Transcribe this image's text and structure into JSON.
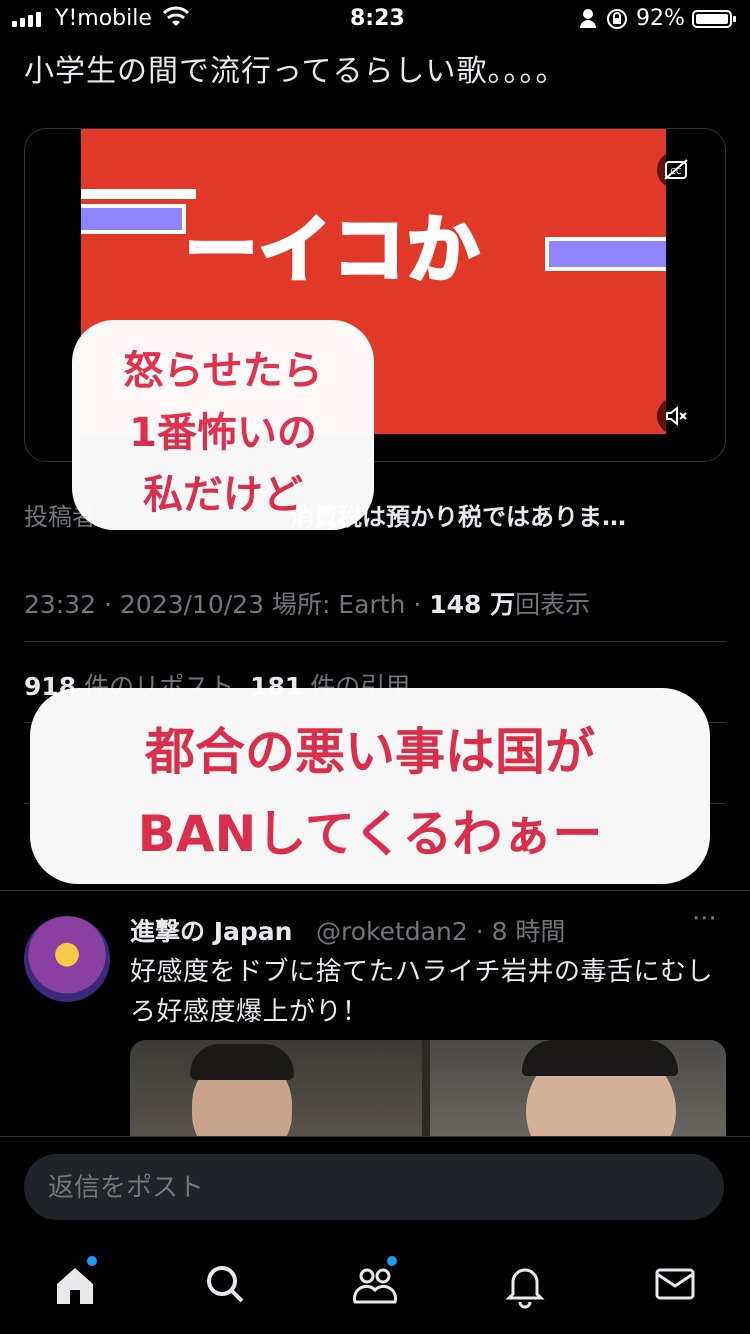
{
  "status_bar": {
    "carrier": "Y!mobile",
    "time": "8:23",
    "battery": "92%"
  },
  "tweet": {
    "text": "小学生の間で流行ってるらしい歌。。。。",
    "thumbnail_text": "ーイコか",
    "posted_by_label": "投稿者:",
    "posted_by_text": "消費税は預かり税ではありま…",
    "time": "23:32",
    "date": "2023/10/23",
    "location": "場所: Earth",
    "views_count": "148 万",
    "views_label": "回表示",
    "reposts_count": "918",
    "reposts_label": "件のリポスト",
    "quotes_count": "181",
    "quotes_label": "件の引用"
  },
  "captions": {
    "bubble1": [
      "怒らせたら",
      "1番怖いの",
      "私だけど"
    ],
    "bubble2": [
      "都合の悪い事は国が",
      "BANしてくるわぁー"
    ]
  },
  "reply_tweet": {
    "name": "進撃の Japan",
    "handle": "@roketdan2",
    "time": "8 時間",
    "more": "···",
    "text": "好感度をドブに捨てたハライチ岩井の毒舌にむしろ好感度爆上がり！"
  },
  "reply_input": {
    "placeholder": "返信をポスト"
  },
  "nav": [
    "home-icon",
    "search-icon",
    "communities-icon",
    "notifications-icon",
    "messages-icon"
  ],
  "colors": {
    "accent": "#1d9bf0",
    "caption": "#e0314f",
    "thumbnail_red": "#e0392a",
    "thumbnail_purple": "#8f86ff"
  }
}
